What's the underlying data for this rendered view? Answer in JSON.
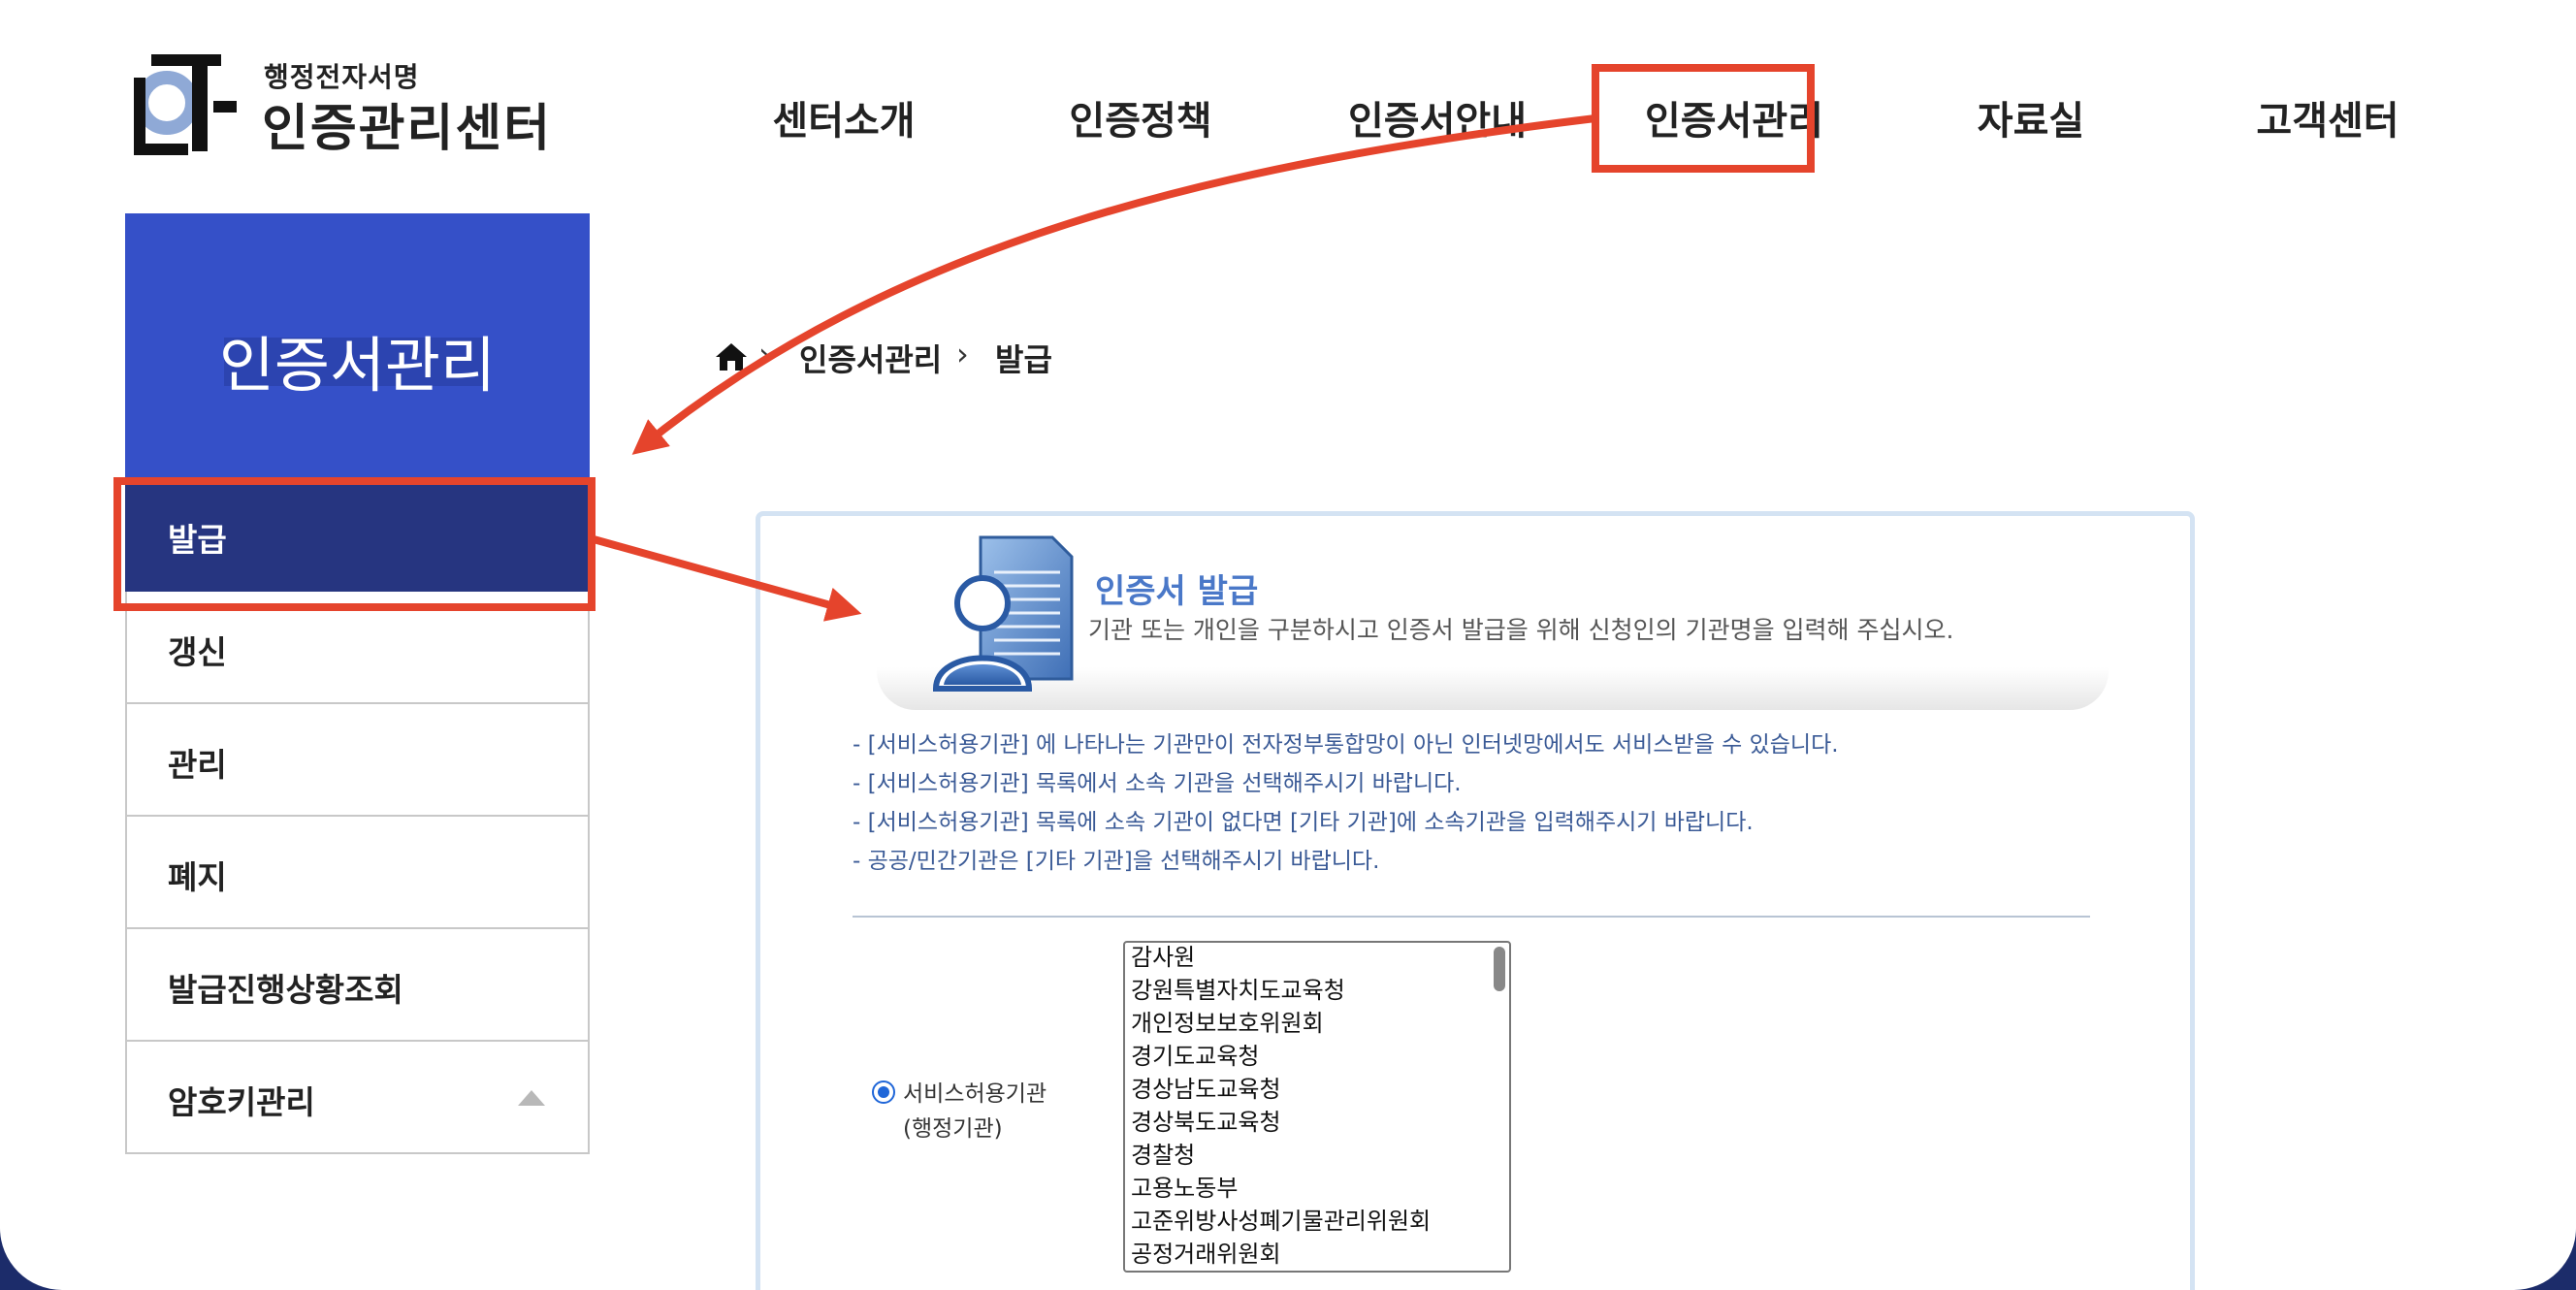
{
  "header": {
    "logo_subtitle": "행정전자서명",
    "logo_title": "인증관리센터",
    "nav": [
      {
        "label": "센터소개"
      },
      {
        "label": "인증정책"
      },
      {
        "label": "인증서안내"
      },
      {
        "label": "인증서관리"
      },
      {
        "label": "자료실"
      },
      {
        "label": "고객센터"
      }
    ]
  },
  "sidebar": {
    "title": "인증서관리",
    "items": [
      {
        "label": "발급",
        "active": true
      },
      {
        "label": "갱신"
      },
      {
        "label": "관리"
      },
      {
        "label": "폐지"
      },
      {
        "label": "발급진행상황조회"
      },
      {
        "label": "암호키관리"
      }
    ]
  },
  "breadcrumb": {
    "items": [
      "인증서관리",
      "발급"
    ]
  },
  "issue": {
    "title": "인증서 발급",
    "description": "기관 또는 개인을 구분하시고 인증서 발급을 위해 신청인의 기관명을 입력해 주십시오.",
    "notices": [
      "- [서비스허용기관] 에 나타나는 기관만이 전자정부통합망이 아닌 인터넷망에서도 서비스받을 수 있습니다.",
      "- [서비스허용기관] 목록에서 소속 기관을 선택해주시기 바랍니다.",
      "- [서비스허용기관] 목록에 소속 기관이 없다면 [기타 기관]에 소속기관을 입력해주시기 바랍니다.",
      "- 공공/민간기관은 [기타 기관]을 선택해주시기 바랍니다."
    ],
    "radio_label_line1": "서비스허용기관",
    "radio_label_line2": "(행정기관)",
    "org_options": [
      "감사원",
      "강원특별자치도교육청",
      "개인정보보호위원회",
      "경기도교육청",
      "경상남도교육청",
      "경상북도교육청",
      "경찰청",
      "고용노동부",
      "고준위방사성폐기물관리위원회",
      "공정거래위원회"
    ]
  },
  "colors": {
    "sidebar_header": "#3550c8",
    "sidebar_active": "#263580",
    "annotation": "#e5442c",
    "issue_title": "#4a78c8",
    "notice_text": "#3a5a96"
  }
}
